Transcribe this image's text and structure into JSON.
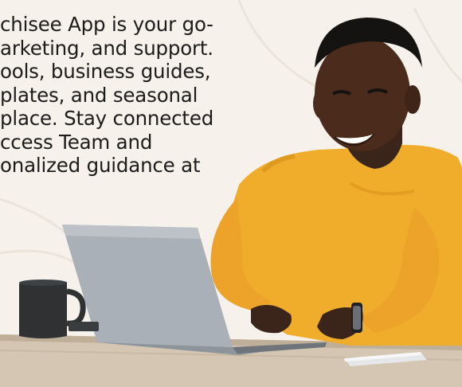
{
  "promo": {
    "lines": [
      "chisee App is your go-",
      "arketing, and support.",
      "ools, business guides,",
      "plates, and seasonal",
      "place. Stay connected",
      "ccess Team and",
      "onalized guidance at"
    ]
  },
  "colors": {
    "background": "#f6f1eb",
    "sweater": "#f0ac2b",
    "laptop": "#a7adb4",
    "mug": "#2f3133",
    "desk": "#cbbba6"
  },
  "icons": [
    "mug-icon",
    "phone-icon",
    "laptop-icon"
  ]
}
